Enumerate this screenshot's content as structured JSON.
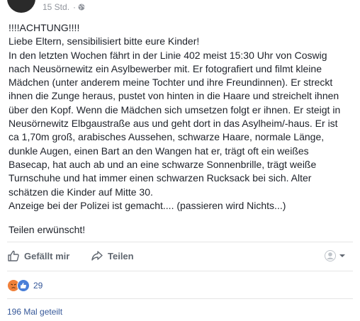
{
  "post": {
    "timestamp": "15 Std.",
    "separator": "·",
    "privacy_icon": "globe-icon",
    "lines": [
      "!!!!ACHTUNG!!!!",
      "Liebe Eltern, sensibilisiert bitte eure Kinder!",
      "In den letzten Wochen fährt in der Linie 402 meist 15:30 Uhr von Coswig",
      "nach Neusörnewitz ein Asylbewerber mit. Er fotografiert und filmt kleine",
      "Mädchen (unter anderem meine Tochter und ihre Freundinnen). Er streckt",
      "ihnen die Zunge heraus, pustet von hinten in die Haare und streichelt ihnen",
      "über den Kopf. Wenn die Mädchen sich umsetzen folgt er ihnen. Er steigt in",
      "Neusörnewitz Elbgaustraße aus und geht dort in das Asylheim/-haus. Er ist",
      "ca 1,70m groß, arabisches Aussehen, schwarze Haare, normale Länge,",
      "dunkle Augen, einen Bart an den Wangen hat er, trägt oft ein weißes",
      "Basecap, hat auch ab und an eine schwarze Sonnenbrille, trägt weiße",
      "Turnschuhe und hat immer einen schwarzen Rucksack bei sich. Alter",
      "schätzen die Kinder auf Mitte 30.",
      "Anzeige bei der Polizei ist gemacht.... (passieren wird Nichts...)"
    ],
    "closing": "Teilen erwünscht!"
  },
  "actions": {
    "like_label": "Gefällt mir",
    "share_label": "Teilen",
    "like_icon": "thumbs-up-icon",
    "share_icon": "share-arrow-icon",
    "viewer_icon": "profile-icon"
  },
  "reactions": {
    "icons": [
      "angry-reaction-icon",
      "like-reaction-icon"
    ],
    "count": "29",
    "colors": {
      "angry": "#f0803a",
      "like": "#4a7fd8"
    }
  },
  "shares": {
    "label": "196 Mal geteilt"
  }
}
